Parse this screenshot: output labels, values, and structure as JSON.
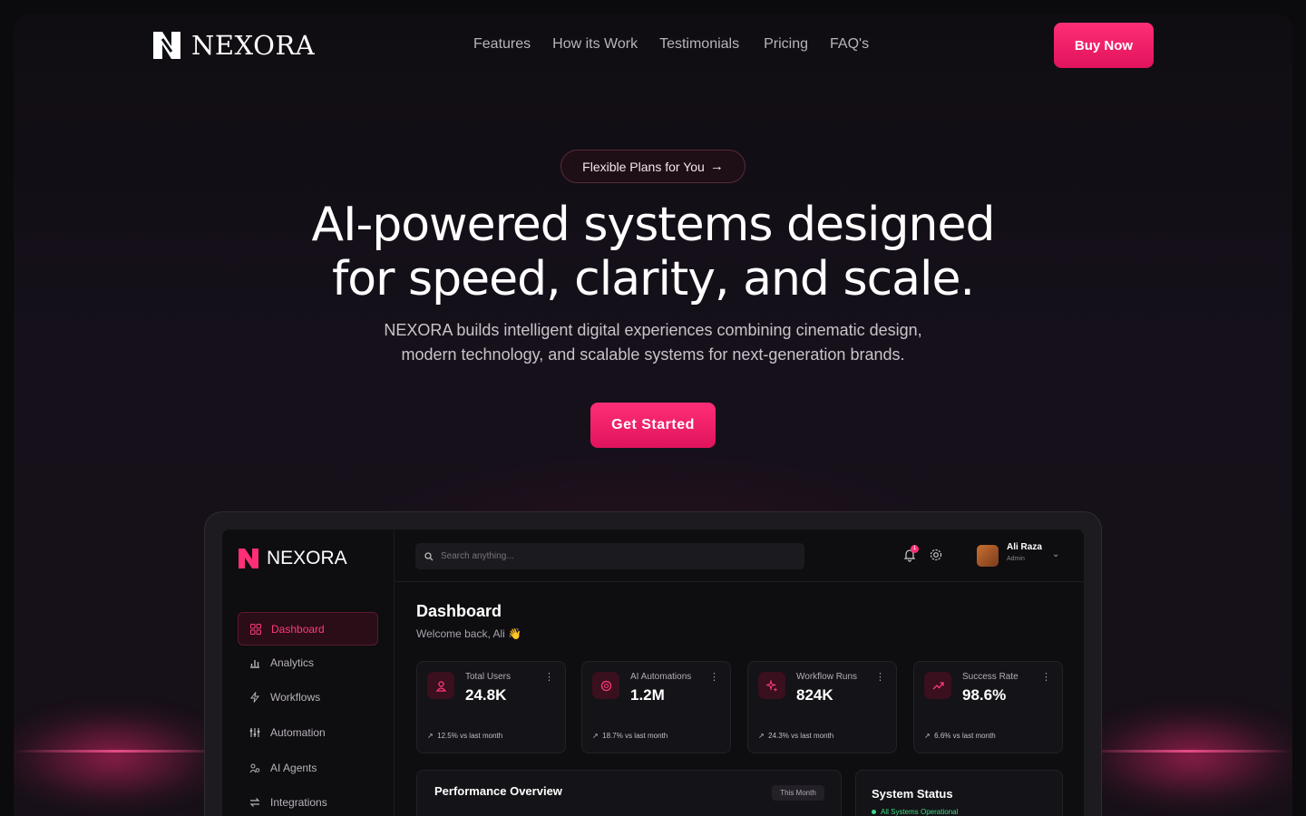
{
  "brand": {
    "name": "NEXORA",
    "accent": "#ff2e76"
  },
  "nav": {
    "links": [
      "Features",
      "How its Work",
      "Testimonials",
      "Pricing",
      "FAQ's"
    ],
    "buy_label": "Buy Now"
  },
  "hero": {
    "pill_label": "Flexible Plans for You",
    "headline_line1": "AI-powered systems designed",
    "headline_line2": "for speed, clarity, and scale.",
    "sub_line1": "NEXORA builds intelligent digital experiences combining cinematic design,",
    "sub_line2": "modern technology, and scalable systems for next-generation brands.",
    "cta_label": "Get Started"
  },
  "dashboard": {
    "brand": "NEXORA",
    "sidebar": [
      {
        "label": "Dashboard",
        "icon": "grid-icon"
      },
      {
        "label": "Analytics",
        "icon": "bar-chart-icon"
      },
      {
        "label": "Workflows",
        "icon": "bolt-icon"
      },
      {
        "label": "Automation",
        "icon": "sliders-icon"
      },
      {
        "label": "AI Agents",
        "icon": "agents-icon"
      },
      {
        "label": "Integrations",
        "icon": "swap-icon"
      }
    ],
    "search_placeholder": "Search anything...",
    "notification_count": "1",
    "user": {
      "name": "Ali Raza",
      "role": "Admin"
    },
    "title": "Dashboard",
    "welcome": "Welcome back, Ali 👋",
    "cards": [
      {
        "label": "Total Users",
        "value": "24.8K",
        "trend": "12.5% vs last month",
        "icon": "user-icon"
      },
      {
        "label": "AI Automations",
        "value": "1.2M",
        "trend": "18.7% vs last month",
        "icon": "brain-icon"
      },
      {
        "label": "Workflow Runs",
        "value": "824K",
        "trend": "24.3% vs last month",
        "icon": "sparkle-icon"
      },
      {
        "label": "Success Rate",
        "value": "98.6%",
        "trend": "6.6% vs last month",
        "icon": "trend-up-icon"
      }
    ],
    "performance": {
      "title": "Performance Overview",
      "range": "This Month"
    },
    "system": {
      "title": "System Status",
      "status": "All Systems Operational"
    }
  }
}
